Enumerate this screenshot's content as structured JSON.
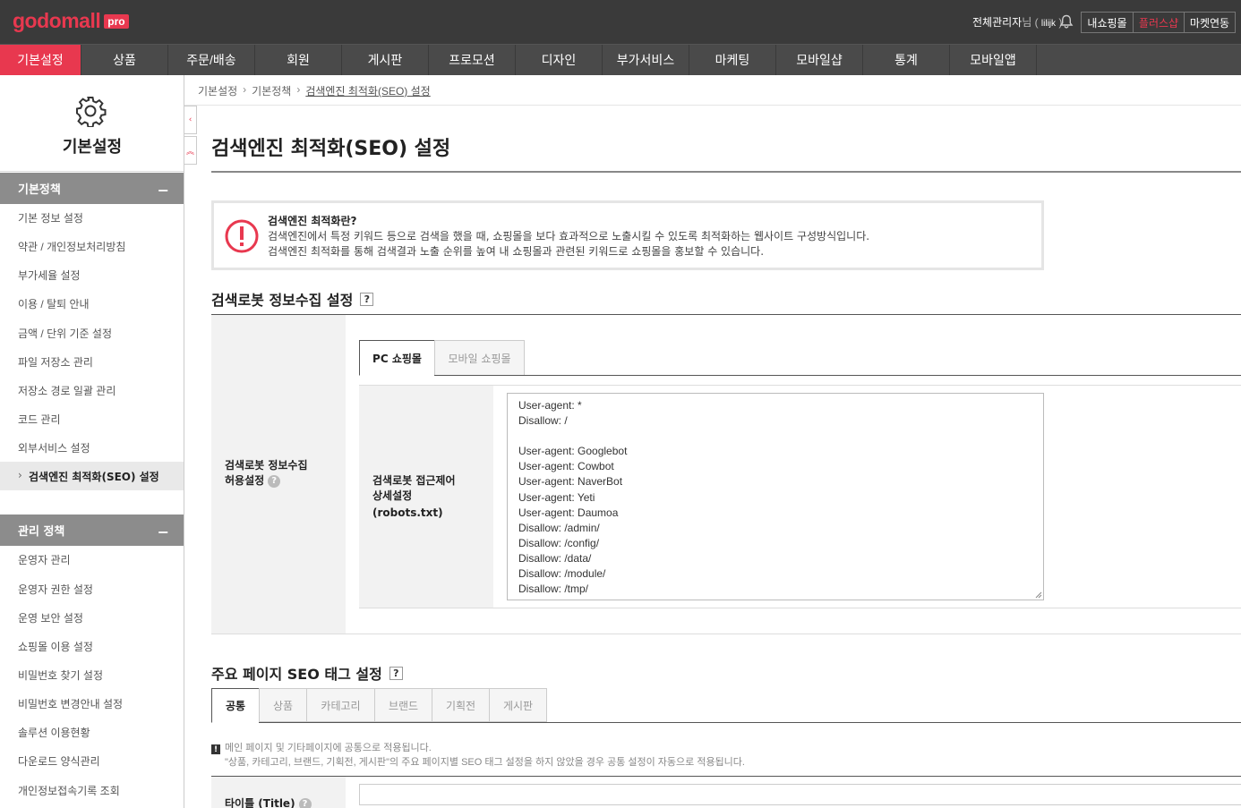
{
  "header": {
    "logo_text": "godomall",
    "logo_badge": "pro",
    "admin_name": "전체관리자",
    "admin_suffix": "님 (",
    "admin_id": "lilijk",
    "admin_close": ")",
    "buttons": [
      "내쇼핑몰",
      "플러스샵",
      "마켓연동"
    ]
  },
  "gnb": [
    "기본설정",
    "상품",
    "주문/배송",
    "회원",
    "게시판",
    "프로모션",
    "디자인",
    "부가서비스",
    "마케팅",
    "모바일샵",
    "통계",
    "모바일앱"
  ],
  "sidebar": {
    "title": "기본설정",
    "group1": "기본정책",
    "group1_items": [
      "기본 정보 설정",
      "약관 / 개인정보처리방침",
      "부가세율 설정",
      "이용 / 탈퇴 안내",
      "금액 / 단위 기준 설정",
      "파일 저장소 관리",
      "저장소 경로 일괄 관리",
      "코드 관리",
      "외부서비스 설정",
      "검색엔진 최적화(SEO) 설정"
    ],
    "group2": "관리 정책",
    "group2_items": [
      "운영자 관리",
      "운영자 권한 설정",
      "운영 보안 설정",
      "쇼핑몰 이용 설정",
      "비밀번호 찾기 설정",
      "비밀번호 변경안내 설정",
      "솔루션 이용현황",
      "다운로드 양식관리",
      "개인정보접속기록 조회"
    ]
  },
  "breadcrumb": [
    "기본설정",
    "기본정책",
    "검색엔진 최적화(SEO) 설정"
  ],
  "page_title": "검색엔진 최적화(SEO) 설정",
  "notice": {
    "title": "검색엔진 최적화란?",
    "line1": "검색엔진에서 특정 키워드 등으로 검색을 했을 때, 쇼핑몰을 보다 효과적으로 노출시킬 수 있도록 최적화하는 웹사이트 구성방식입니다.",
    "line2": "검색엔진 최적화를 통해 검색결과 노출 순위를 높여 내 쇼핑몰과 관련된 키워드로 쇼핑몰을 홍보할 수 있습니다."
  },
  "section1": {
    "title": "검색로봇 정보수집 설정",
    "q": "?",
    "row_label": "검색로봇 정보수집 허용설정",
    "row_label_l1": "검색로봇 정보수집",
    "row_label_l2": "허용설정",
    "tabs": [
      "PC 쇼핑몰",
      "모바일 쇼핑몰"
    ],
    "sub_label_l1": "검색로봇 접근제어",
    "sub_label_l2": "상세설정",
    "sub_label_l3": "(robots.txt)",
    "robots_txt": "User-agent: *\nDisallow: /\n\nUser-agent: Googlebot\nUser-agent: Cowbot\nUser-agent: NaverBot\nUser-agent: Yeti\nUser-agent: Daumoa\nDisallow: /admin/\nDisallow: /config/\nDisallow: /data/\nDisallow: /module/\nDisallow: /tmp/"
  },
  "section2": {
    "title": "주요 페이지 SEO 태그 설정",
    "q": "?",
    "tabs": [
      "공통",
      "상품",
      "카테고리",
      "브랜드",
      "기획전",
      "게시판"
    ],
    "info1": "메인 페이지 및 기타페이지에 공통으로 적용됩니다.",
    "info2": "\"상품, 카테고리, 브랜드, 기획전, 게시판\"의 주요 페이지별 SEO 태그 설정을 하지 않았을 경우 공통 설정이 자동으로 적용됩니다.",
    "title_label": "타이틀 (Title)"
  },
  "colors": {
    "brand": "#e8384f",
    "header_bg": "#3a3a3a",
    "gnb_bg": "#4a4a4a"
  }
}
